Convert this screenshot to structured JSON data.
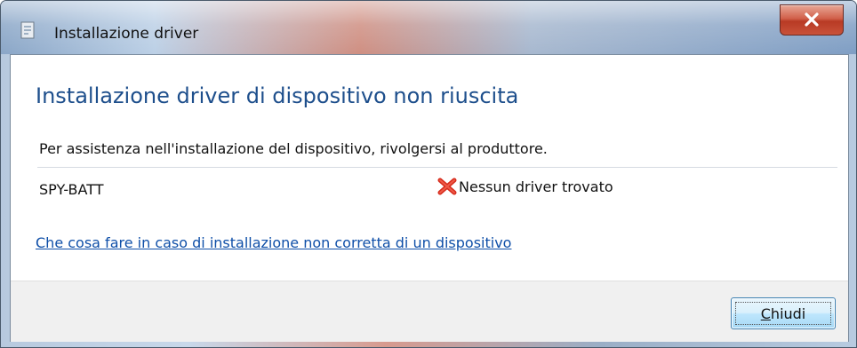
{
  "window": {
    "title": "Installazione driver",
    "title_icon": "installer-icon",
    "close_icon": "close-x-icon"
  },
  "content": {
    "heading": "Installazione driver di dispositivo non riuscita",
    "instructions": "Per assistenza nell'installazione del dispositivo, rivolgersi al produttore.",
    "device": {
      "name": "SPY-BATT",
      "status": "Nessun driver trovato",
      "status_icon": "error-x-icon",
      "status_color": "#d62a1b"
    },
    "help_link": "Che cosa fare in caso di installazione non corretta di un dispositivo"
  },
  "footer": {
    "close_label_accel": "C",
    "close_label_rest": "hiudi"
  },
  "colors": {
    "heading": "#1e4f8c",
    "link": "#0f4fa8",
    "close_button": "#c9523a"
  }
}
